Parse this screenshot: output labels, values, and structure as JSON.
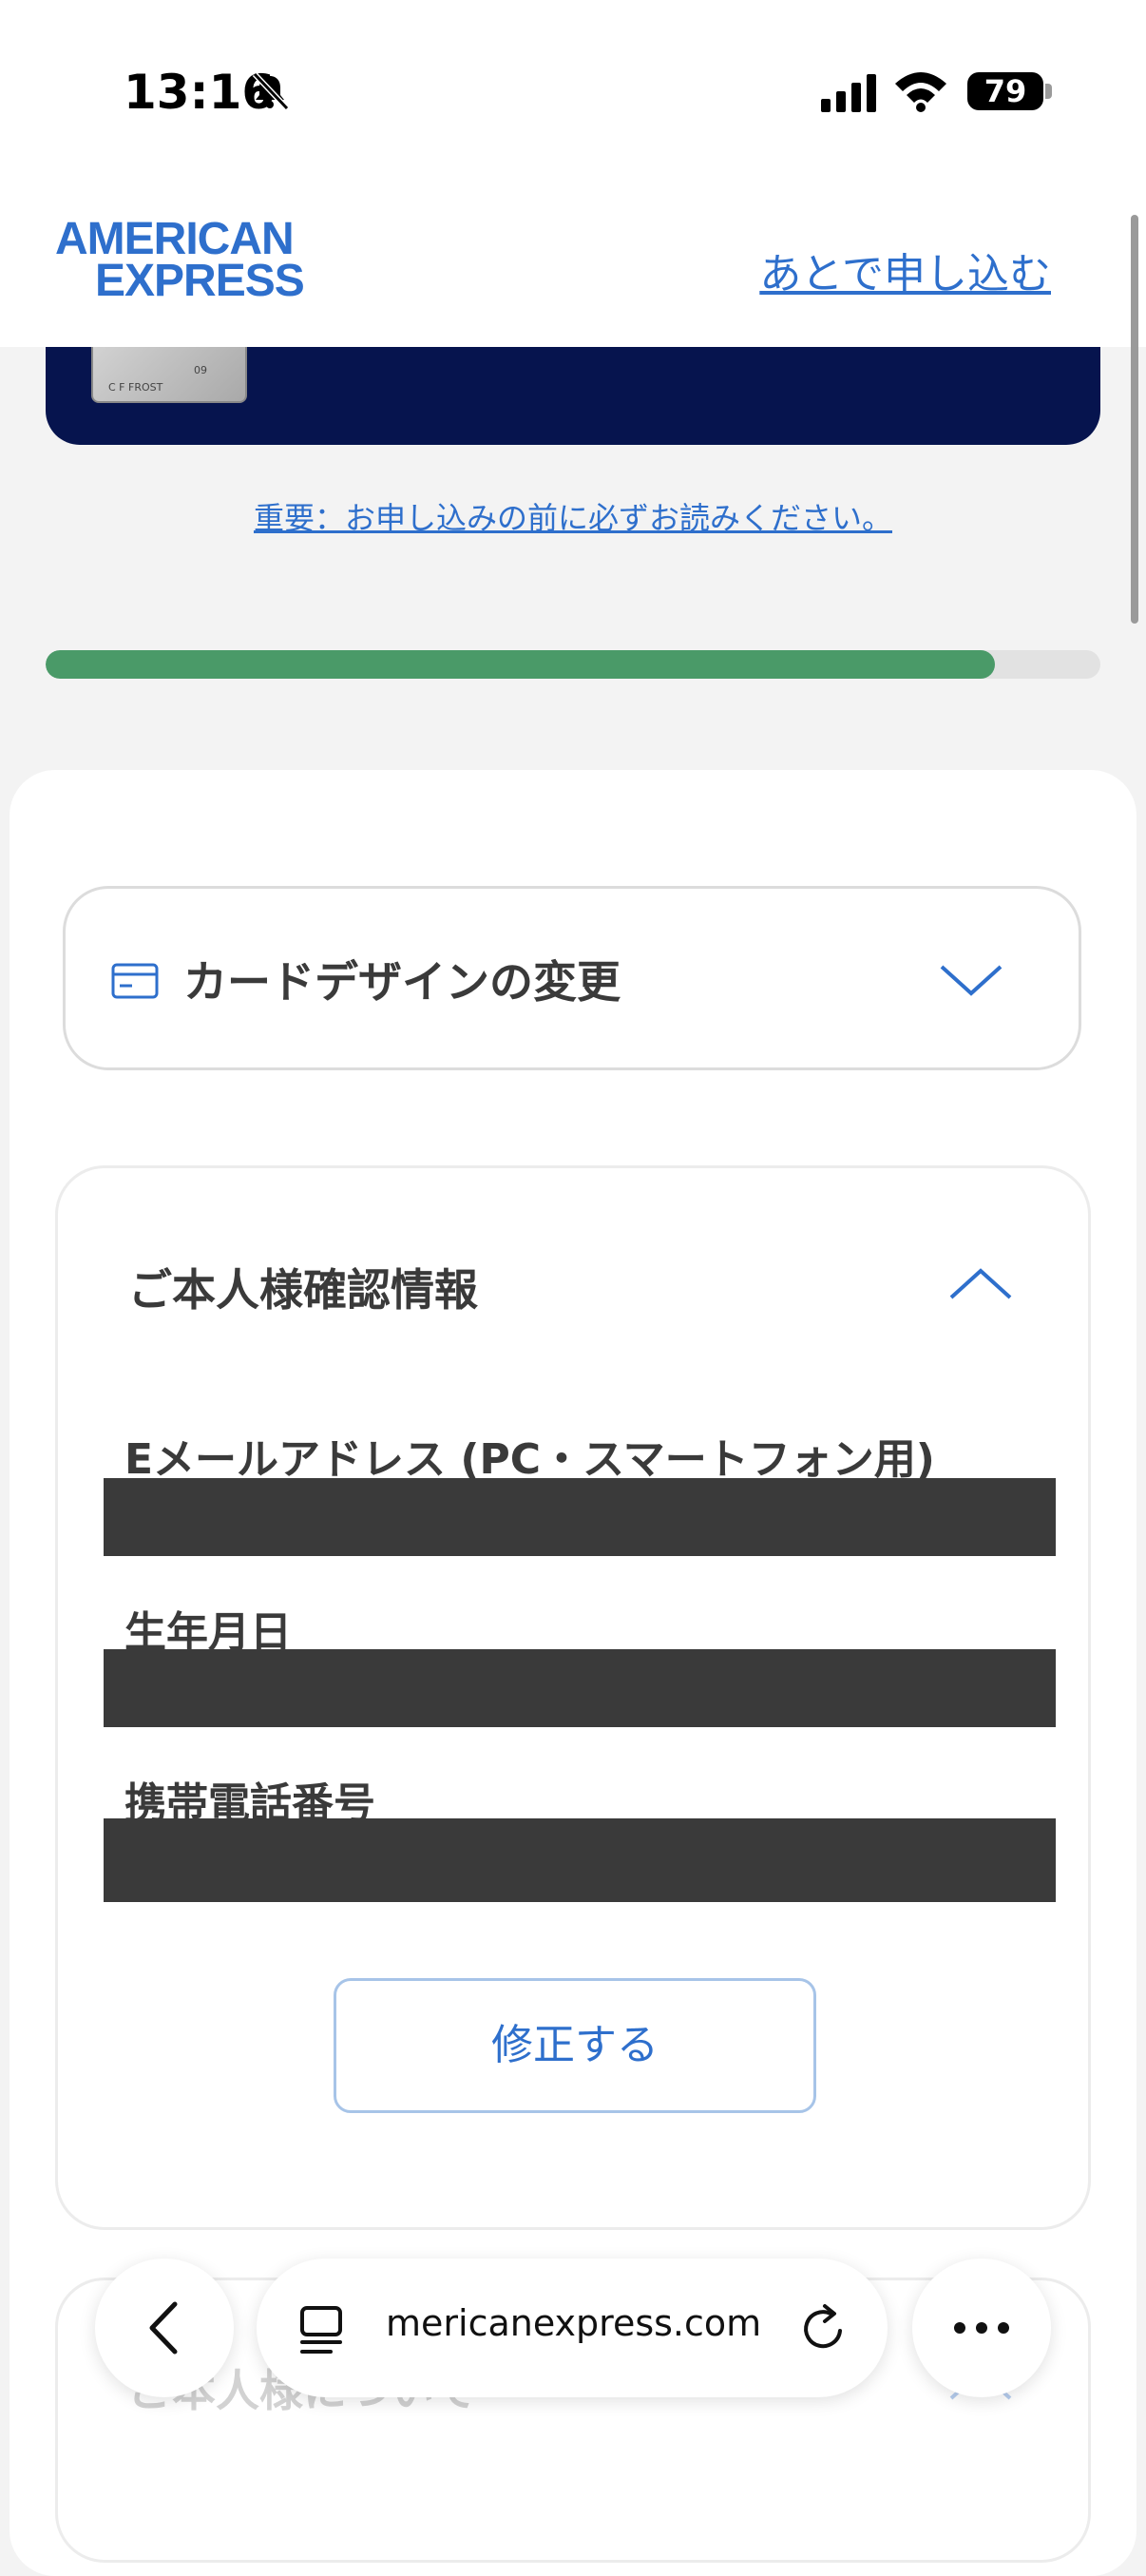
{
  "status_bar": {
    "time": "13:16",
    "battery": "79"
  },
  "header": {
    "logo_line1": "AMERICAN",
    "logo_line2": "EXPRESS",
    "later_link": "あとで申し込む"
  },
  "card_banner": {
    "thumb_name": "C F FROST",
    "thumb_number": "09"
  },
  "notice_link": "重要：お申し込みの前に必ずお読みください。",
  "progress": {
    "fraction": 0.9
  },
  "card_design_section": {
    "title": "カードデザインの変更",
    "icon": "credit-card-icon",
    "state": "collapsed"
  },
  "identity_section": {
    "title": "ご本人様確認情報",
    "state": "expanded",
    "fields": [
      {
        "label": "Eメールアドレス (PC・スマートフォン用)"
      },
      {
        "label": "生年月日"
      },
      {
        "label": "携帯電話番号"
      }
    ],
    "edit_button": "修正する"
  },
  "next_section": {
    "title": "ご本人様について"
  },
  "browser": {
    "url": "americanexpress.com",
    "url_visible": "mericanexpress.com"
  },
  "colors": {
    "brand_blue": "#2e6fcc",
    "banner_navy": "#06144e",
    "progress_green": "#4a9a68"
  }
}
